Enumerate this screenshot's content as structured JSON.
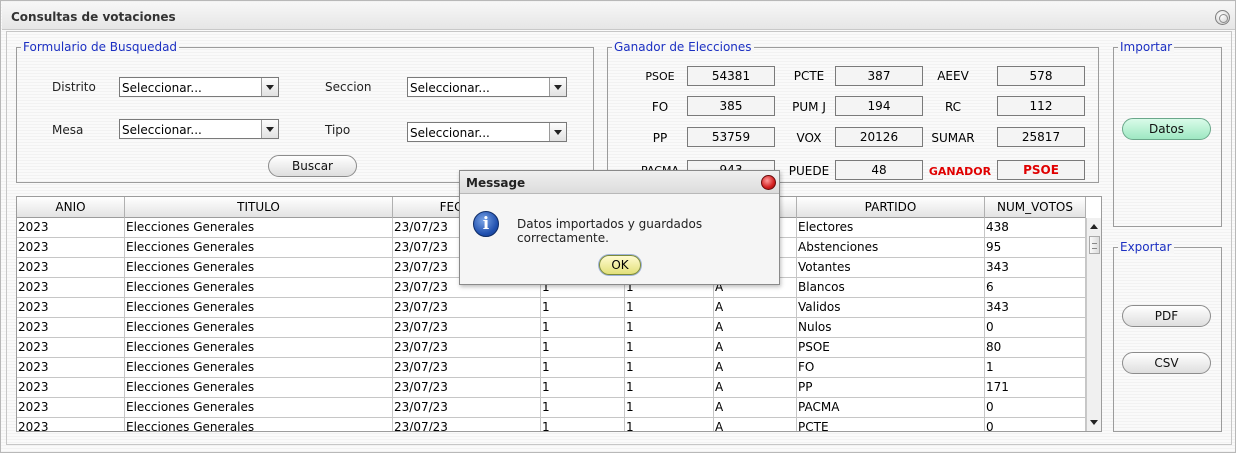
{
  "window": {
    "title": "Consultas de votaciones"
  },
  "form": {
    "legend": "Formulario de Busquedad",
    "distrito_label": "Distrito",
    "distrito_value": "Seleccionar...",
    "seccion_label": "Seccion",
    "seccion_value": "Seleccionar...",
    "mesa_label": "Mesa",
    "mesa_value": "Seleccionar...",
    "tipo_label": "Tipo",
    "tipo_value": "Seleccionar...",
    "buscar_label": "Buscar"
  },
  "ganador": {
    "legend": "Ganador de Elecciones",
    "psoe_label": "PSOE",
    "psoe_value": "54381",
    "pcte_label": "PCTE",
    "pcte_value": "387",
    "aeev_label": "AEEV",
    "aeev_value": "578",
    "fo_label": "FO",
    "fo_value": "385",
    "pumj_label": "PUM J",
    "pumj_value": "194",
    "rc_label": "RC",
    "rc_value": "112",
    "pp_label": "PP",
    "pp_value": "53759",
    "vox_label": "VOX",
    "vox_value": "20126",
    "sumar_label": "SUMAR",
    "sumar_value": "25817",
    "pacma_label": "PACMA",
    "pacma_value": "943",
    "puede_label": "PUEDE",
    "puede_value": "48",
    "winner_label": "GANADOR",
    "winner_value": "PSOE",
    "winner_color": "#e00000"
  },
  "importar": {
    "legend": "Importar",
    "datos_label": "Datos"
  },
  "exportar": {
    "legend": "Exportar",
    "pdf_label": "PDF",
    "csv_label": "CSV"
  },
  "table": {
    "headers": [
      "ANIO",
      "TITULO",
      "FECHA_E",
      "",
      "",
      "",
      "PARTIDO",
      "NUM_VOTOS"
    ],
    "rows": [
      [
        "2023",
        "Elecciones Generales",
        "23/07/23",
        "",
        "",
        "",
        "Electores",
        "438"
      ],
      [
        "2023",
        "Elecciones Generales",
        "23/07/23",
        "",
        "",
        "",
        "Abstenciones",
        "95"
      ],
      [
        "2023",
        "Elecciones Generales",
        "23/07/23",
        "",
        "",
        "",
        "Votantes",
        "343"
      ],
      [
        "2023",
        "Elecciones Generales",
        "23/07/23",
        "1",
        "1",
        "A",
        "Blancos",
        "6"
      ],
      [
        "2023",
        "Elecciones Generales",
        "23/07/23",
        "1",
        "1",
        "A",
        "Validos",
        "343"
      ],
      [
        "2023",
        "Elecciones Generales",
        "23/07/23",
        "1",
        "1",
        "A",
        "Nulos",
        "0"
      ],
      [
        "2023",
        "Elecciones Generales",
        "23/07/23",
        "1",
        "1",
        "A",
        "PSOE",
        "80"
      ],
      [
        "2023",
        "Elecciones Generales",
        "23/07/23",
        "1",
        "1",
        "A",
        "FO",
        "1"
      ],
      [
        "2023",
        "Elecciones Generales",
        "23/07/23",
        "1",
        "1",
        "A",
        "PP",
        "171"
      ],
      [
        "2023",
        "Elecciones Generales",
        "23/07/23",
        "1",
        "1",
        "A",
        "PACMA",
        "0"
      ],
      [
        "2023",
        "Elecciones Generales",
        "23/07/23",
        "1",
        "1",
        "A",
        "PCTE",
        "0"
      ]
    ]
  },
  "dialog": {
    "title": "Message",
    "message": "Datos importados y guardados correctamente.",
    "ok_label": "OK",
    "icon": "info-icon"
  }
}
